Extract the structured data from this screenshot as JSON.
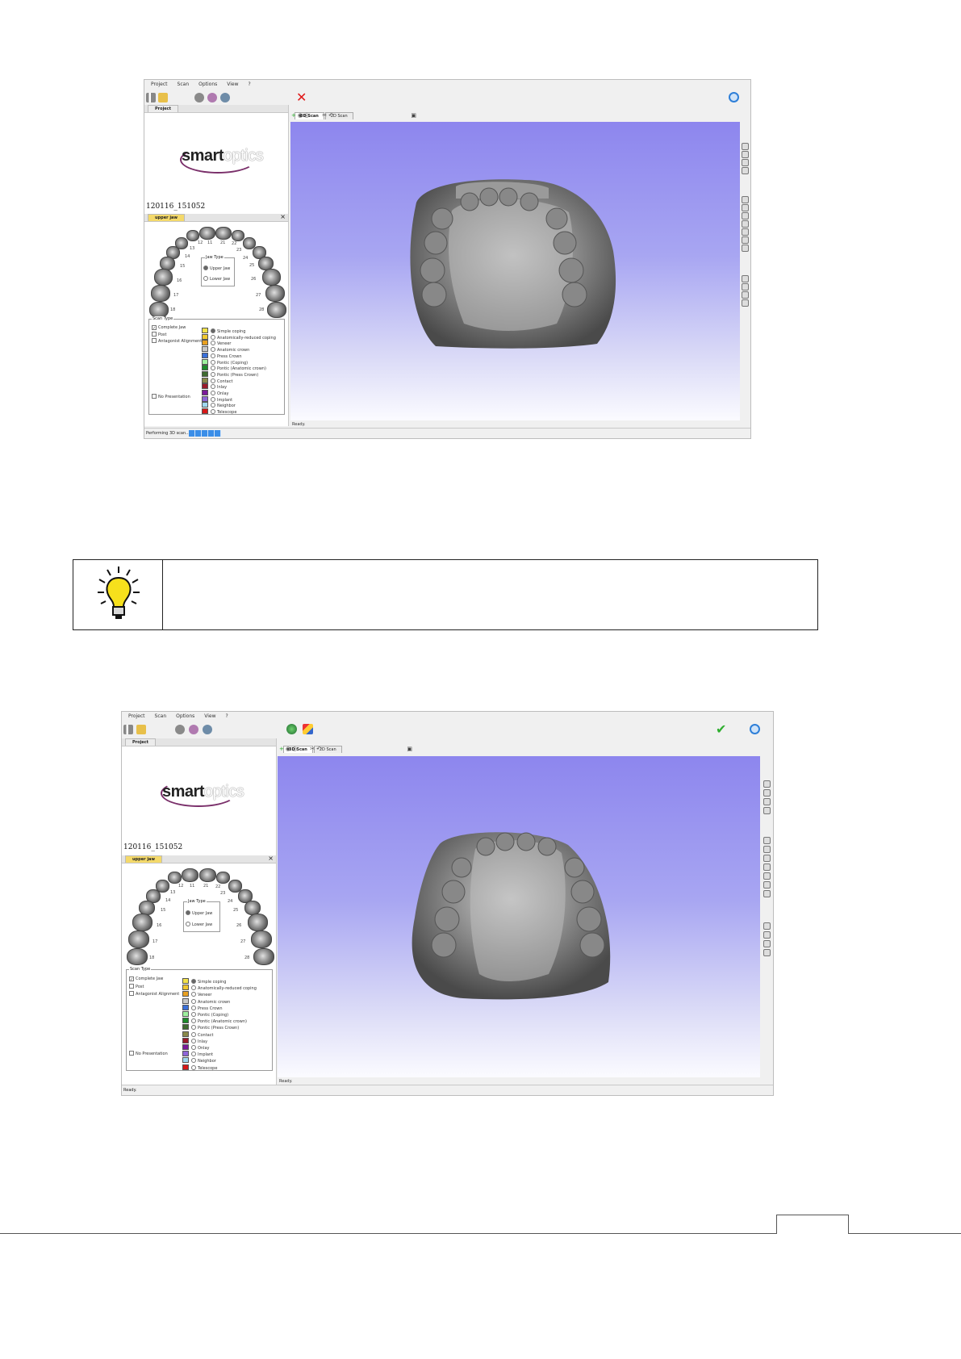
{
  "screenshot1": {
    "menu": [
      "Project",
      "Scan",
      "Options",
      "View",
      "?"
    ],
    "project_tab": "Project",
    "logo_bold": "smart",
    "logo_light": "optics",
    "project_id": "120116_151052",
    "jaw_tab": "upper jaw",
    "tooth_numbers": [
      "12",
      "11",
      "21",
      "22",
      "13",
      "23",
      "14",
      "24",
      "15",
      "25",
      "16",
      "26",
      "17",
      "27",
      "18",
      "28"
    ],
    "jaw_type": {
      "title": "Jaw Type",
      "upper": "Upper Jaw",
      "lower": "Lower Jaw",
      "selected": "upper"
    },
    "scan_type": {
      "title": "Scan Type",
      "complete_jaw": "Complete Jaw",
      "post": "Post",
      "antagonist": "Antagonist Alignment",
      "no_presentation": "No Presentation"
    },
    "restorations": [
      {
        "label": "Simple coping",
        "color": "#f2e24a"
      },
      {
        "label": "Anatomically-reduced coping",
        "color": "#f0c830"
      },
      {
        "label": "Veneer",
        "color": "#e8a020"
      },
      {
        "label": "Anatomic crown",
        "color": "#c8c8c8"
      },
      {
        "label": "Press Crown",
        "color": "#3a6fd8"
      },
      {
        "label": "Pontic (Coping)",
        "color": "#9ef09e"
      },
      {
        "label": "Pontic (Anatomic crown)",
        "color": "#1c8a2a"
      },
      {
        "label": "Pontic (Press Crown)",
        "color": "#3f6b30"
      },
      {
        "label": "Contact",
        "color": "#8a8a4a"
      },
      {
        "label": "Inlay",
        "color": "#9a1a2a"
      },
      {
        "label": "Onlay",
        "color": "#7a1a9a"
      },
      {
        "label": "Implant",
        "color": "#8e66d8"
      },
      {
        "label": "Neighbor",
        "color": "#9ed8f0"
      },
      {
        "label": "Telescope",
        "color": "#d81818"
      }
    ],
    "view_tabs": [
      "3D Scan",
      "2D Scan"
    ],
    "view_status": "Ready.",
    "status": "Performing 3D scan..."
  },
  "screenshot2": {
    "menu": [
      "Project",
      "Scan",
      "Options",
      "View",
      "?"
    ],
    "project_tab": "Project",
    "logo_bold": "smart",
    "logo_light": "optics",
    "project_id": "120116_151052",
    "jaw_tab": "upper jaw",
    "tooth_numbers": [
      "12",
      "11",
      "21",
      "22",
      "13",
      "23",
      "14",
      "24",
      "15",
      "25",
      "16",
      "26",
      "17",
      "27",
      "18",
      "28"
    ],
    "jaw_type": {
      "title": "Jaw Type",
      "upper": "Upper Jaw",
      "lower": "Lower Jaw",
      "selected": "upper"
    },
    "scan_type": {
      "title": "Scan Type",
      "complete_jaw": "Complete Jaw",
      "post": "Post",
      "antagonist": "Antagonist Alignment",
      "no_presentation": "No Presentation"
    },
    "restorations": [
      {
        "label": "Simple coping",
        "color": "#f2e24a"
      },
      {
        "label": "Anatomically-reduced coping",
        "color": "#f0c830"
      },
      {
        "label": "Veneer",
        "color": "#e8a020"
      },
      {
        "label": "Anatomic crown",
        "color": "#c8c8c8"
      },
      {
        "label": "Press Crown",
        "color": "#3a6fd8"
      },
      {
        "label": "Pontic (Coping)",
        "color": "#9ef09e"
      },
      {
        "label": "Pontic (Anatomic crown)",
        "color": "#1c8a2a"
      },
      {
        "label": "Pontic (Press Crown)",
        "color": "#3f6b30"
      },
      {
        "label": "Contact",
        "color": "#8a8a4a"
      },
      {
        "label": "Inlay",
        "color": "#9a1a2a"
      },
      {
        "label": "Onlay",
        "color": "#7a1a9a"
      },
      {
        "label": "Implant",
        "color": "#8e66d8"
      },
      {
        "label": "Neighbor",
        "color": "#9ed8f0"
      },
      {
        "label": "Telescope",
        "color": "#d81818"
      }
    ],
    "view_tabs": [
      "3D Scan",
      "2D Scan"
    ],
    "view_status": "Ready.",
    "status": "Ready."
  },
  "icons": {
    "tip": "lightbulb-icon",
    "cancel": "red-x-icon",
    "confirm": "green-check-icon",
    "refresh": "blue-refresh-icon"
  }
}
